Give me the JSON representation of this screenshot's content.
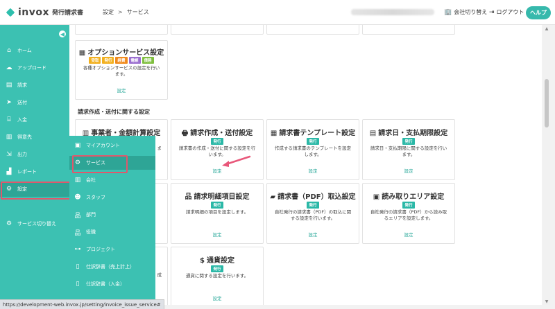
{
  "header": {
    "logo_text": "invox",
    "logo_sub": "発行請求書",
    "breadcrumb": [
      "設定",
      "サービス"
    ],
    "switch_company": "会社切り替え",
    "logout": "ログアウト",
    "help": "ヘルプ"
  },
  "sidebar": {
    "items": [
      {
        "label": "ホーム",
        "icon": "home-icon"
      },
      {
        "label": "アップロード",
        "icon": "cloud-upload-icon"
      },
      {
        "label": "請求",
        "icon": "document-icon"
      },
      {
        "label": "送付",
        "icon": "send-icon"
      },
      {
        "label": "入金",
        "icon": "bank-icon"
      },
      {
        "label": "得意先",
        "icon": "building-icon"
      },
      {
        "label": "出力",
        "icon": "export-icon"
      },
      {
        "label": "レポート",
        "icon": "chart-icon"
      },
      {
        "label": "設定",
        "icon": "gear-icon"
      },
      {
        "label": "サービス切り替え",
        "icon": "switch-icon"
      }
    ]
  },
  "submenu": {
    "items": [
      {
        "label": "マイアカウント",
        "icon": "user-icon"
      },
      {
        "label": "サービス",
        "icon": "gears-icon"
      },
      {
        "label": "会社",
        "icon": "office-icon"
      },
      {
        "label": "スタッフ",
        "icon": "users-icon"
      },
      {
        "label": "部門",
        "icon": "hierarchy-icon"
      },
      {
        "label": "役職",
        "icon": "org-icon"
      },
      {
        "label": "プロジェクト",
        "icon": "project-icon"
      },
      {
        "label": "仕訳辞書（売上計上）",
        "icon": "book-icon"
      },
      {
        "label": "仕訳辞書（入金）",
        "icon": "book-icon"
      }
    ]
  },
  "option_card": {
    "title": "オプションサービス設定",
    "tags": [
      {
        "label": "受取",
        "color": "#f2b01e"
      },
      {
        "label": "発行",
        "color": "#f2b01e"
      },
      {
        "label": "経費",
        "color": "#f08a1d"
      },
      {
        "label": "電帳",
        "color": "#9b6fd0"
      },
      {
        "label": "債務",
        "color": "#7fbf3f"
      }
    ],
    "desc": "各種オプションサービスの設定を行います。",
    "link": "設定"
  },
  "section": {
    "title": "請求作成・送付に関する設定"
  },
  "cards": [
    {
      "title": "事業者・金額計算設定",
      "tag": "",
      "desc": "ま",
      "link": ""
    },
    {
      "title": "請求作成・送付設定",
      "tag": "発行",
      "desc": "請求書の作成・送付に関する設定を行います。",
      "link": "設定"
    },
    {
      "title": "請求書テンプレート設定",
      "tag": "発行",
      "desc": "作成する請求書のテンプレートを設定します。",
      "link": "設定"
    },
    {
      "title": "請求日・支払期限設定",
      "tag": "発行",
      "desc": "請求日・支払期限に関する設定を行います。",
      "link": "設定"
    },
    {
      "title": "請求明細項目設定",
      "tag": "発行",
      "desc": "請求明細の項目を設定します。",
      "link": "設定"
    },
    {
      "title": "請求書（PDF）取込設定",
      "tag": "発行",
      "desc": "自社発行の請求書（PDF）の取込に関する設定を行います。",
      "link": "設定"
    },
    {
      "title": "読み取りエリア設定",
      "tag": "発行",
      "desc": "自社発行の請求書（PDF）から読み取るエリアを設定します。",
      "link": "設定"
    },
    {
      "title": "通貨設定",
      "tag": "発行",
      "desc": "通貨に関する設定を行います。",
      "link": "設定"
    }
  ],
  "partial": {
    "char": "成"
  },
  "status_url": "https://development-web.invox.jp/setting/invoice_issue_service#"
}
